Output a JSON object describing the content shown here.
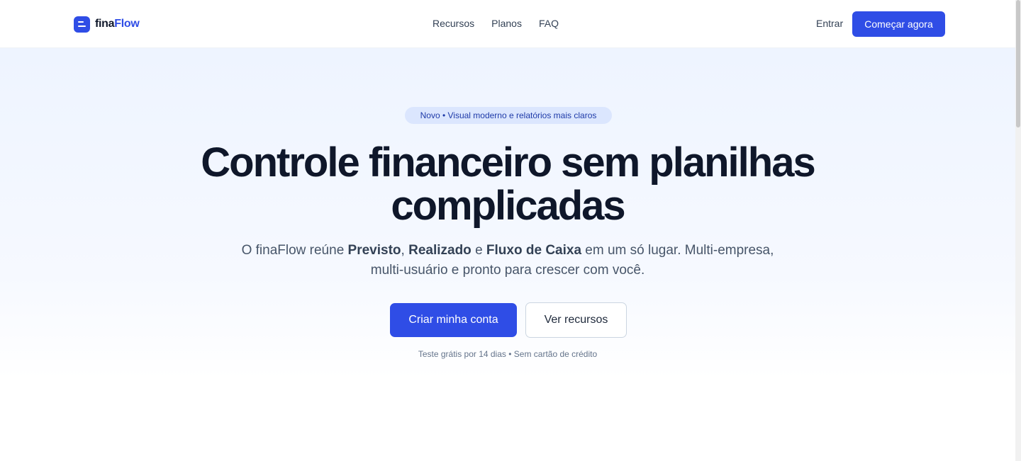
{
  "header": {
    "brand_part1": "fina",
    "brand_part2": "Flow",
    "nav": [
      "Recursos",
      "Planos",
      "FAQ"
    ],
    "login_label": "Entrar",
    "cta_label": "Começar agora"
  },
  "hero": {
    "badge": "Novo • Visual moderno e relatórios mais claros",
    "headline_line1": "Controle financeiro sem planilhas",
    "headline_line2": "complicadas",
    "subtitle": {
      "t1": "O finaFlow reúne ",
      "b1": "Previsto",
      "t2": ", ",
      "b2": "Realizado",
      "t3": " e ",
      "b3": "Fluxo de Caixa",
      "t4": " em um só lugar. Multi-empresa,",
      "t5": "multi-usuário e pronto para crescer com você."
    },
    "primary_button": "Criar minha conta",
    "secondary_button": "Ver recursos",
    "note": "Teste grátis por 14 dias • Sem cartão de crédito"
  },
  "colors": {
    "accent": "#2f4de6",
    "heading": "#0f172a",
    "badge_bg": "#dbe6fe"
  },
  "icons": {
    "logo": "finaflow-logo-icon"
  }
}
